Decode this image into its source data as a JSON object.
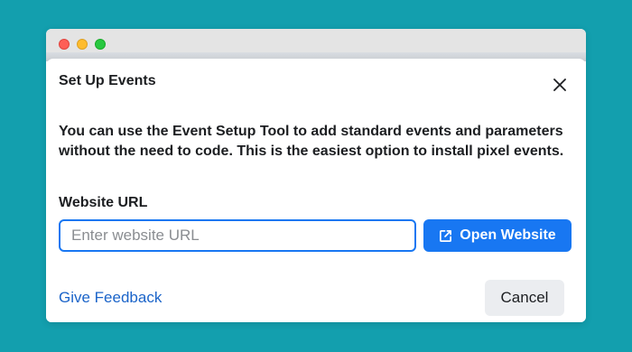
{
  "window": {
    "controls": [
      "close",
      "minimize",
      "maximize"
    ]
  },
  "dialog": {
    "title": "Set Up Events",
    "close_icon": "close-icon",
    "description": "You can use the Event Setup Tool to add standard events and parameters without the need to code. This is the easiest option to install pixel events.",
    "url_label": "Website URL",
    "url_value": "",
    "url_placeholder": "Enter website URL",
    "open_button_icon": "external-link-icon",
    "open_button_label": "Open Website",
    "feedback_link": "Give Feedback",
    "cancel_label": "Cancel"
  },
  "colors": {
    "background": "#139fae",
    "primary": "#1877f2",
    "link": "#1b64c9",
    "secondary_button": "#ebedf0"
  }
}
